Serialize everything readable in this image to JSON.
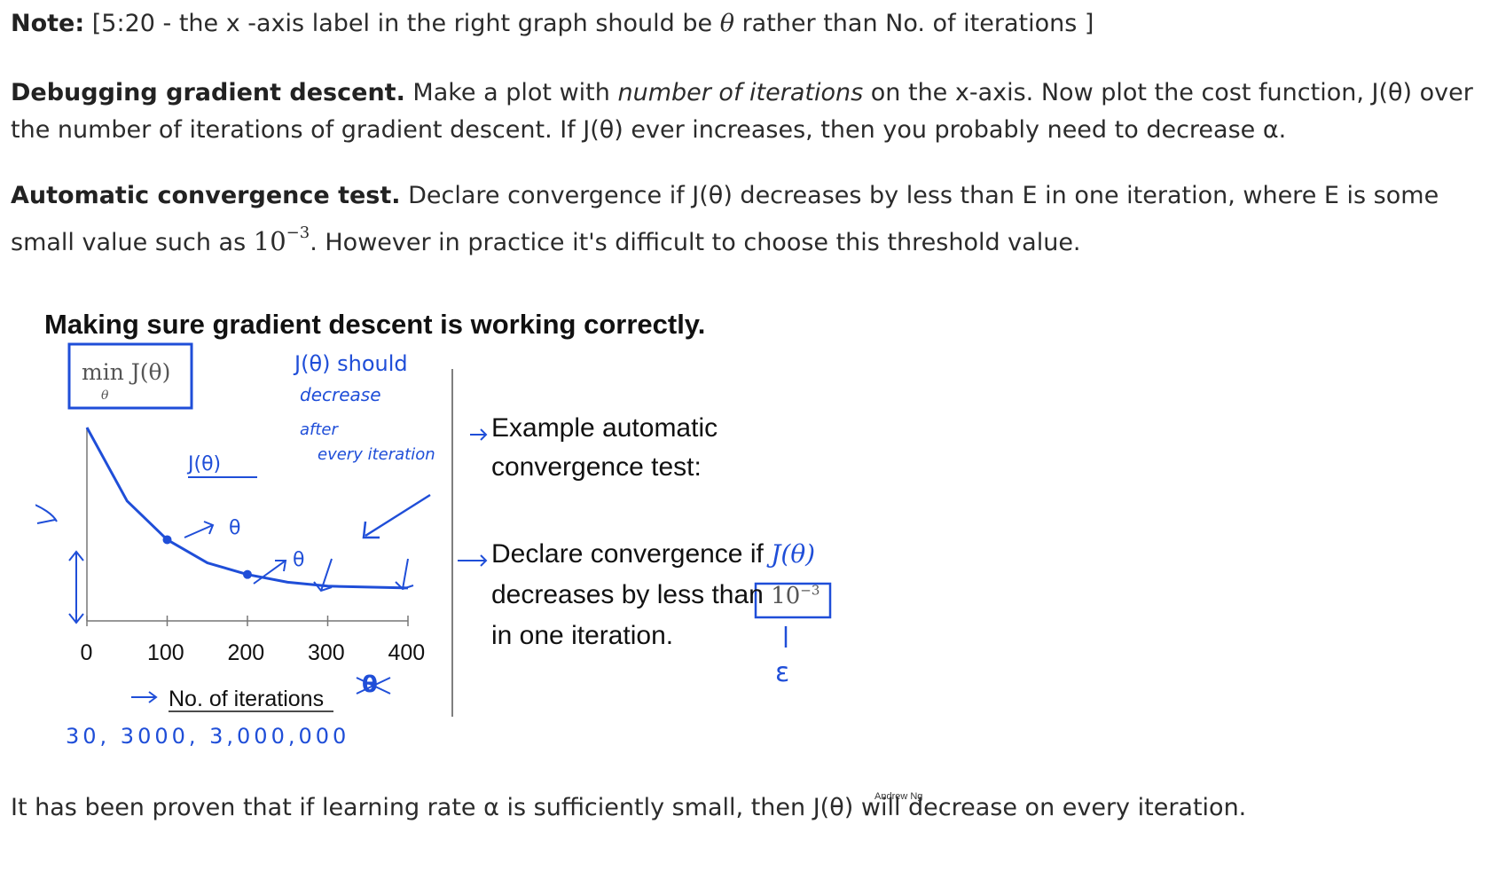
{
  "note": {
    "label": "Note:",
    "text": "[5:20 - the x -axis label in the right graph should be",
    "symbol": "θ",
    "rest": "rather than No. of iterations ]"
  },
  "debugging": {
    "heading": "Debugging gradient descent.",
    "text_before": "Make a plot with",
    "italic": "number of iterations",
    "text_after": "on the x-axis. Now plot the cost function, J(θ) over the number of iterations of gradient descent. If J(θ) ever increases, then you probably need to decrease α."
  },
  "convergence": {
    "heading": "Automatic convergence test.",
    "text": "Declare convergence if J(θ) decreases by less than E in one iteration, where E is some small value such as",
    "value_base": "10",
    "value_exp": "−3",
    "text_after": ". However in practice it's difficult to choose this threshold value."
  },
  "slide": {
    "title": "Making sure gradient descent is working correctly.",
    "min_label": "min J(θ)",
    "min_sub": "θ",
    "hand_notes": {
      "should": "J(θ) should",
      "decrease": "decrease",
      "after": "after",
      "every_iteration": "every iteration",
      "j_theta": "J(θ)",
      "theta1": "θ",
      "theta2": "θ",
      "row_values": "30,   3000,   3,000,000",
      "epsilon": "ε"
    },
    "right_text": {
      "line1": "Example automatic",
      "line2": "convergence test:",
      "line3": "Declare convergence if",
      "line3_math": "J(θ)",
      "line4": "decreases by less than",
      "line4_math": "10",
      "line4_exp": "−3",
      "line5": "in one iteration."
    },
    "credit": "Andrew Ng"
  },
  "closing": {
    "text": "It has been proven that if learning rate α is sufficiently small, then J(θ) will decrease on every iteration."
  },
  "chart_data": {
    "type": "line",
    "xlabel": "No. of iterations",
    "x_ticks": [
      0,
      100,
      200,
      300,
      400
    ],
    "series": [
      {
        "x": [
          0,
          50,
          100,
          150,
          200,
          250,
          300,
          350,
          400
        ],
        "y": [
          1.0,
          0.62,
          0.42,
          0.3,
          0.24,
          0.2,
          0.18,
          0.175,
          0.17
        ]
      }
    ],
    "marked_points": [
      {
        "x": 100,
        "y": 0.42
      },
      {
        "x": 200,
        "y": 0.24
      }
    ],
    "colors": {
      "curve": "#1f4ed8",
      "axes": "#777777"
    }
  }
}
